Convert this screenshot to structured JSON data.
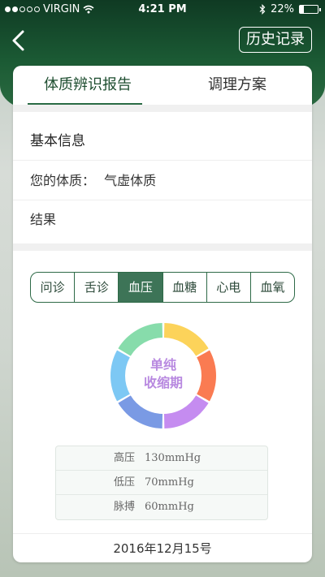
{
  "status": {
    "carrier": "VIRGIN",
    "time": "4:21 PM",
    "battery_percent": "22%",
    "battery_level": 0.22
  },
  "nav": {
    "back_icon": "chevron-left-icon",
    "history_label": "历史记录"
  },
  "tabs": [
    {
      "label": "体质辨识报告",
      "active": true
    },
    {
      "label": "调理方案",
      "active": false
    }
  ],
  "basic_info": {
    "title": "基本信息",
    "constitution_label": "您的体质：",
    "constitution_value": "气虚体质",
    "result_label": "结果"
  },
  "segments": [
    {
      "label": "问诊",
      "active": false
    },
    {
      "label": "舌诊",
      "active": false
    },
    {
      "label": "血压",
      "active": true
    },
    {
      "label": "血糖",
      "active": false
    },
    {
      "label": "心电",
      "active": false
    },
    {
      "label": "血氧",
      "active": false
    }
  ],
  "donut": {
    "line1": "单纯",
    "line2": "收缩期",
    "colors": [
      "#fcd35a",
      "#fa7b52",
      "#c58cf0",
      "#7a9ae4",
      "#7dc8f4",
      "#87dcab"
    ],
    "label_color": "#b889e0"
  },
  "readings": [
    {
      "label": "高压",
      "value": "130mmHg"
    },
    {
      "label": "低压",
      "value": "70mmHg"
    },
    {
      "label": "脉搏",
      "value": "60mmHg"
    }
  ],
  "date": "2016年12月15号",
  "colors": {
    "brand": "#1b5a34",
    "segment_active": "#3d7457"
  }
}
